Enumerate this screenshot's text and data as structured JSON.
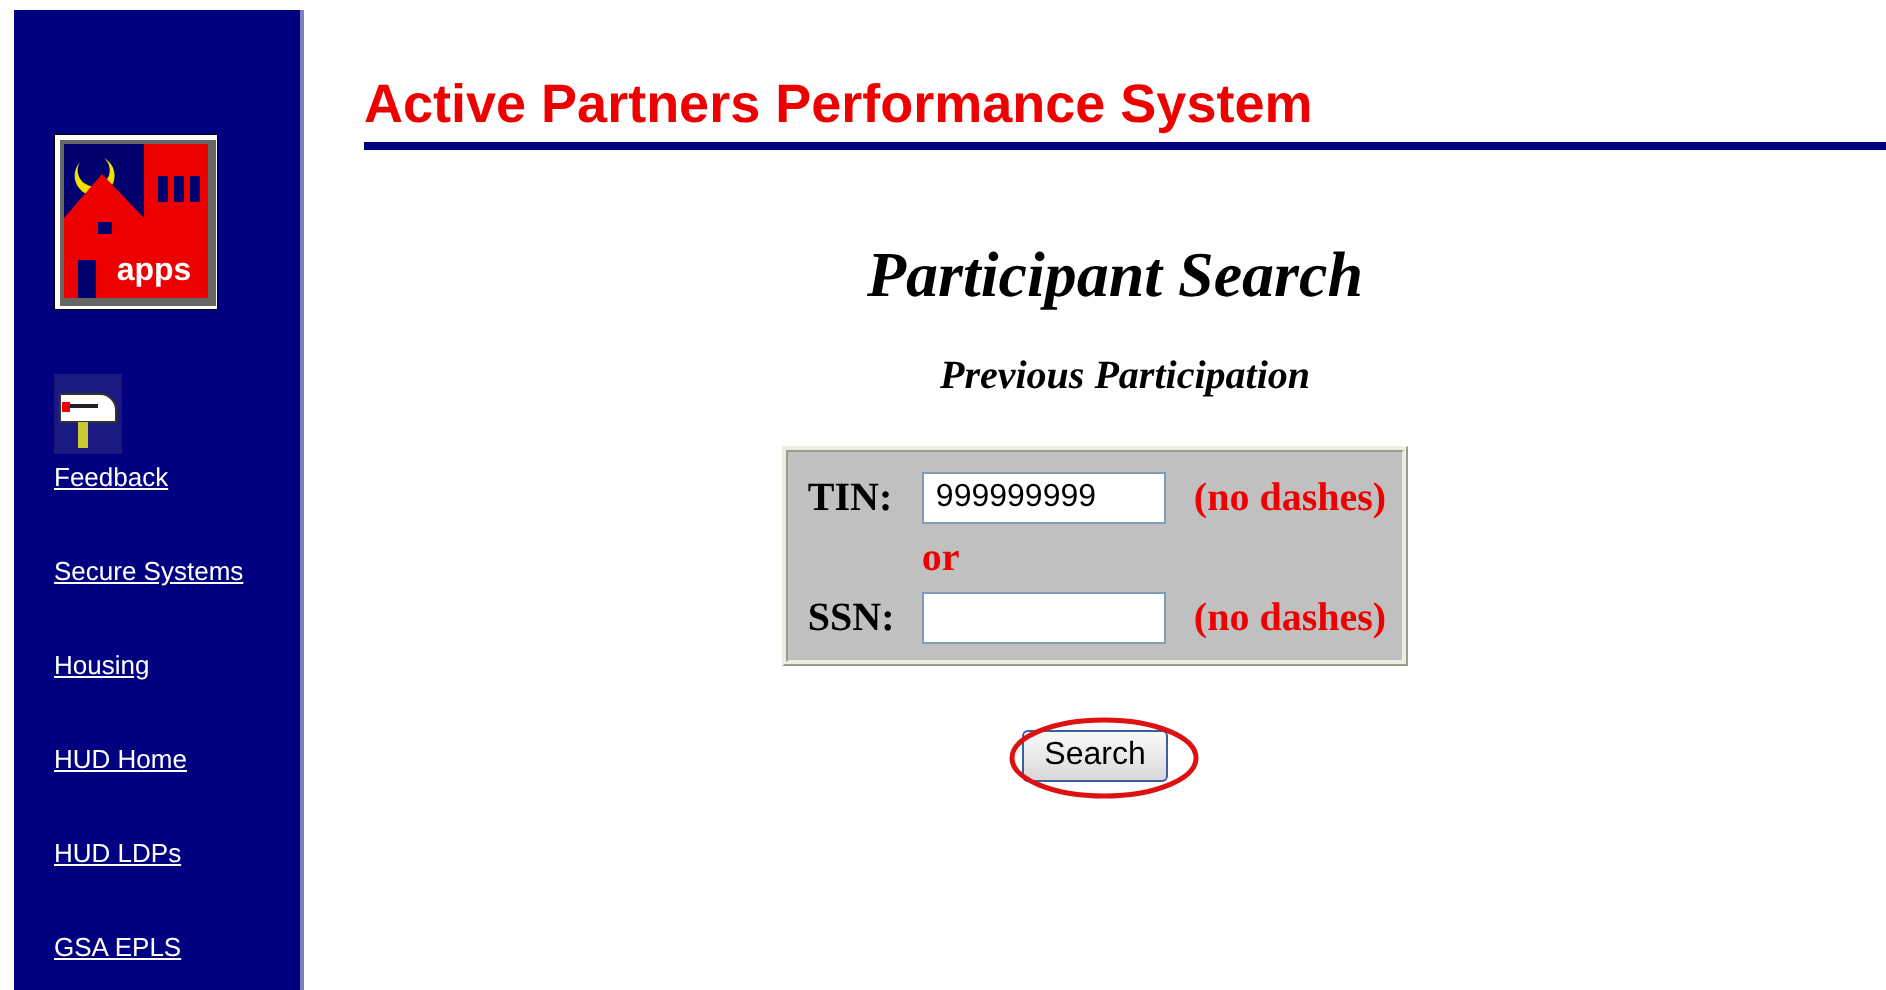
{
  "sidebar": {
    "links": [
      {
        "label": "Feedback",
        "kind": "mailbox"
      },
      {
        "label": "Secure Systems"
      },
      {
        "label": "Housing"
      },
      {
        "label": "HUD Home"
      },
      {
        "label": "HUD LDPs"
      },
      {
        "label": "GSA EPLS"
      }
    ],
    "logo_text": "apps"
  },
  "header": {
    "title": "Active Partners Performance System"
  },
  "page_title": "Participant Search",
  "subtitle": "Previous Participation",
  "form": {
    "fields": [
      {
        "label": "TIN:",
        "value": "999999999",
        "hint": "(no dashes)"
      },
      {
        "label": "SSN:",
        "hint": "(no dashes)"
      }
    ],
    "separator": "or"
  },
  "search_button": {
    "label": "Search",
    "highlighted": true
  }
}
